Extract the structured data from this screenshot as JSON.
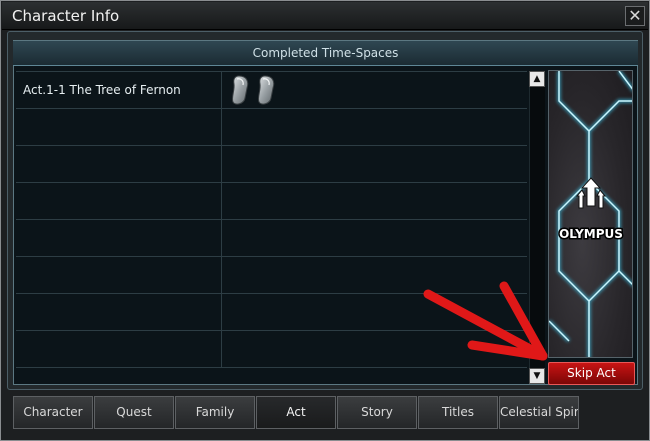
{
  "window": {
    "title": "Character Info",
    "close_label": "✕"
  },
  "section": {
    "header": "Completed Time-Spaces"
  },
  "rows": [
    {
      "name": "Act.1-1 The Tree of Fernon",
      "badges": 2
    },
    {
      "name": "",
      "badges": 0
    },
    {
      "name": "",
      "badges": 0
    },
    {
      "name": "",
      "badges": 0
    },
    {
      "name": "",
      "badges": 0
    },
    {
      "name": "",
      "badges": 0
    },
    {
      "name": "",
      "badges": 0
    },
    {
      "name": "",
      "badges": 0
    }
  ],
  "scroll": {
    "up": "▲",
    "down": "▼"
  },
  "banner": {
    "logo_text": "OLYMPUS",
    "icon": "olympus-emblem-icon"
  },
  "skip_button": {
    "label": "Skip Act"
  },
  "tabs": [
    {
      "label": "Character",
      "active": false
    },
    {
      "label": "Quest",
      "active": false
    },
    {
      "label": "Family",
      "active": false
    },
    {
      "label": "Act",
      "active": true
    },
    {
      "label": "Story",
      "active": false
    },
    {
      "label": "Titles",
      "active": false
    },
    {
      "label": "Celestial Spire",
      "active": false
    }
  ],
  "colors": {
    "accent_red": "#c81414",
    "glow_cyan": "#3fd7ff",
    "annotation_arrow": "#e01818"
  }
}
